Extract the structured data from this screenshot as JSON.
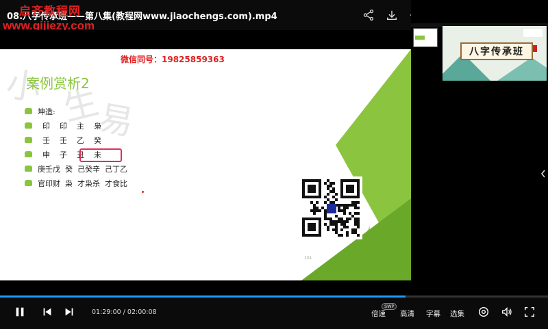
{
  "titlebar": {
    "title": "08.八字传承班——第八集(教程网www.jiaochengs.com).mp4",
    "watermark_top": "启齐教程网",
    "watermark_url": "www.qijiezy.com",
    "icons": [
      "share-icon",
      "download-icon",
      "more-icon",
      "picture-in-picture-icon",
      "pin-icon",
      "minimize-icon",
      "maximize-icon",
      "close-icon"
    ]
  },
  "slide": {
    "wechat": "微信同号：19825859363",
    "heading": "案例赏析2",
    "brush_chars": [
      "小",
      "生",
      "易"
    ],
    "rows": [
      "坤造:",
      "  印    印    主    枭",
      "  壬    壬    乙    癸",
      "  申    子    丑    未",
      "庚壬戊  癸  己癸辛  己丁乙",
      "官印财  枭  才枭杀  才食比"
    ],
    "page_number": "101",
    "colors": {
      "accent_green": "#8bc53f",
      "highlight_red": "#e0305a",
      "wechat_red": "#e02020"
    }
  },
  "player": {
    "progress_fraction": 0.74,
    "current_time": "01:29:00",
    "total_time": "02:00:08",
    "time_separator": " / ",
    "speed_label": "倍速",
    "swp_badge": "SWP",
    "quality_label": "高清",
    "subtitle_label": "字幕",
    "episodes_label": "选集",
    "icons": [
      "pause-icon",
      "previous-icon",
      "next-icon",
      "settings-icon",
      "volume-icon",
      "fullscreen-icon"
    ],
    "accent_color": "#1e9bff"
  },
  "side_panel": {
    "preview_title": "八字传承班"
  }
}
